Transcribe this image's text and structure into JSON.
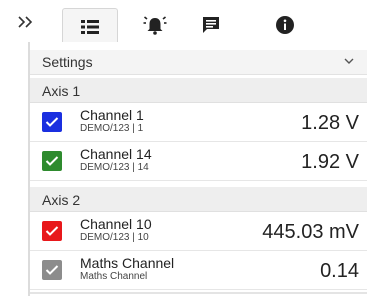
{
  "toolbar": {
    "expand_icon": "double-chevron-right",
    "tabs": [
      {
        "icon": "list-icon",
        "active": true
      },
      {
        "icon": "alarm-bell-icon",
        "active": false
      },
      {
        "icon": "comment-icon",
        "active": false
      },
      {
        "icon": "info-icon",
        "active": false
      }
    ],
    "icon_color": "#222222"
  },
  "settings": {
    "label": "Settings"
  },
  "axes": [
    {
      "label": "Axis 1",
      "channels": [
        {
          "name": "Channel 1",
          "source": "DEMO/123 | 1",
          "value": "1.28 V",
          "color": "#1a2fe0",
          "checked": true
        },
        {
          "name": "Channel 14",
          "source": "DEMO/123 | 14",
          "value": "1.92 V",
          "color": "#2e8b2e",
          "checked": true
        }
      ]
    },
    {
      "label": "Axis 2",
      "channels": [
        {
          "name": "Channel 10",
          "source": "DEMO/123 | 10",
          "value": "445.03 mV",
          "color": "#e8181b",
          "checked": true
        },
        {
          "name": "Maths Channel",
          "source": "Maths Channel",
          "value": "0.14",
          "color": "#8c8c8c",
          "checked": true
        }
      ]
    }
  ]
}
